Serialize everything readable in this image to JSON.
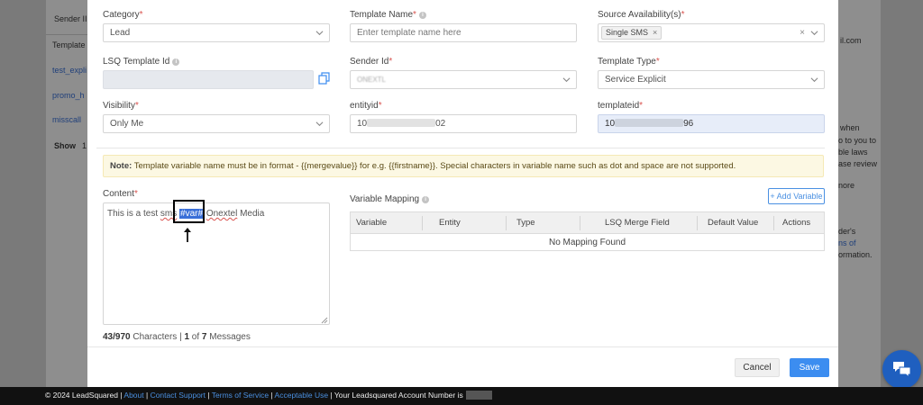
{
  "background": {
    "left_panel": {
      "header_label": "Sender II",
      "column_label": "Template",
      "links": [
        "test_expli",
        "promo_h",
        "misscall"
      ],
      "show_label": "Show",
      "show_value": "1"
    },
    "right_panel": {
      "email_fragment": "il.com",
      "lines": [
        "when",
        "o to you to",
        "ble laws",
        "ase review",
        "nore",
        "der's",
        "ns of",
        "ormation."
      ]
    }
  },
  "form": {
    "category": {
      "label": "Category",
      "value": "Lead"
    },
    "template_name": {
      "label": "Template Name",
      "placeholder": "Enter template name here"
    },
    "source_availability": {
      "label": "Source Availability(s)",
      "chip": "Single SMS"
    },
    "lsq_template_id": {
      "label": "LSQ Template Id"
    },
    "sender_id": {
      "label": "Sender Id",
      "value": "ONEXTL"
    },
    "template_type": {
      "label": "Template Type",
      "value": "Service Explicit"
    },
    "visibility": {
      "label": "Visibility",
      "value": "Only Me"
    },
    "entityid": {
      "label": "entityid",
      "prefix": "10",
      "suffix": "02"
    },
    "templateid": {
      "label": "templateid",
      "prefix": "10",
      "suffix": "96"
    }
  },
  "note": {
    "bold": "Note:",
    "text": "Template variable name must be in format - {{mergevalue}} for e.g. {{firstname}}. Special characters in variable name such as dot and space are not supported."
  },
  "content": {
    "label": "Content",
    "text_before": "This is a test ",
    "text_sms": "sms",
    "text_space": " ",
    "variable": "#var#",
    "text_space2": " ",
    "text_brand": "Onextel",
    "text_after": " Media",
    "counter": {
      "count": "43/970",
      "characters_label": "Characters",
      "separator": "|",
      "current": "1",
      "of_label": "of",
      "total": "7",
      "messages_label": "Messages"
    }
  },
  "variable_mapping": {
    "label": "Variable Mapping",
    "add_button": "+ Add Variable",
    "columns": [
      "Variable",
      "Entity",
      "Type",
      "LSQ Merge Field",
      "Default Value",
      "Actions"
    ],
    "empty_text": "No Mapping Found"
  },
  "buttons": {
    "cancel": "Cancel",
    "save": "Save"
  },
  "footer": {
    "copyright": "© 2024 LeadSquared | ",
    "about": "About",
    "sep1": " | ",
    "contact": "Contact Support",
    "sep2": " | ",
    "terms": "Terms of Service",
    "sep3": " | ",
    "acceptable": "Acceptable Use",
    "account_text": " | Your Leadsquared Account Number is"
  },
  "colors": {
    "accent": "#3c8df0",
    "required": "#d9534f",
    "note_bg": "#fcf8e3",
    "chat": "#1f5fbf"
  }
}
